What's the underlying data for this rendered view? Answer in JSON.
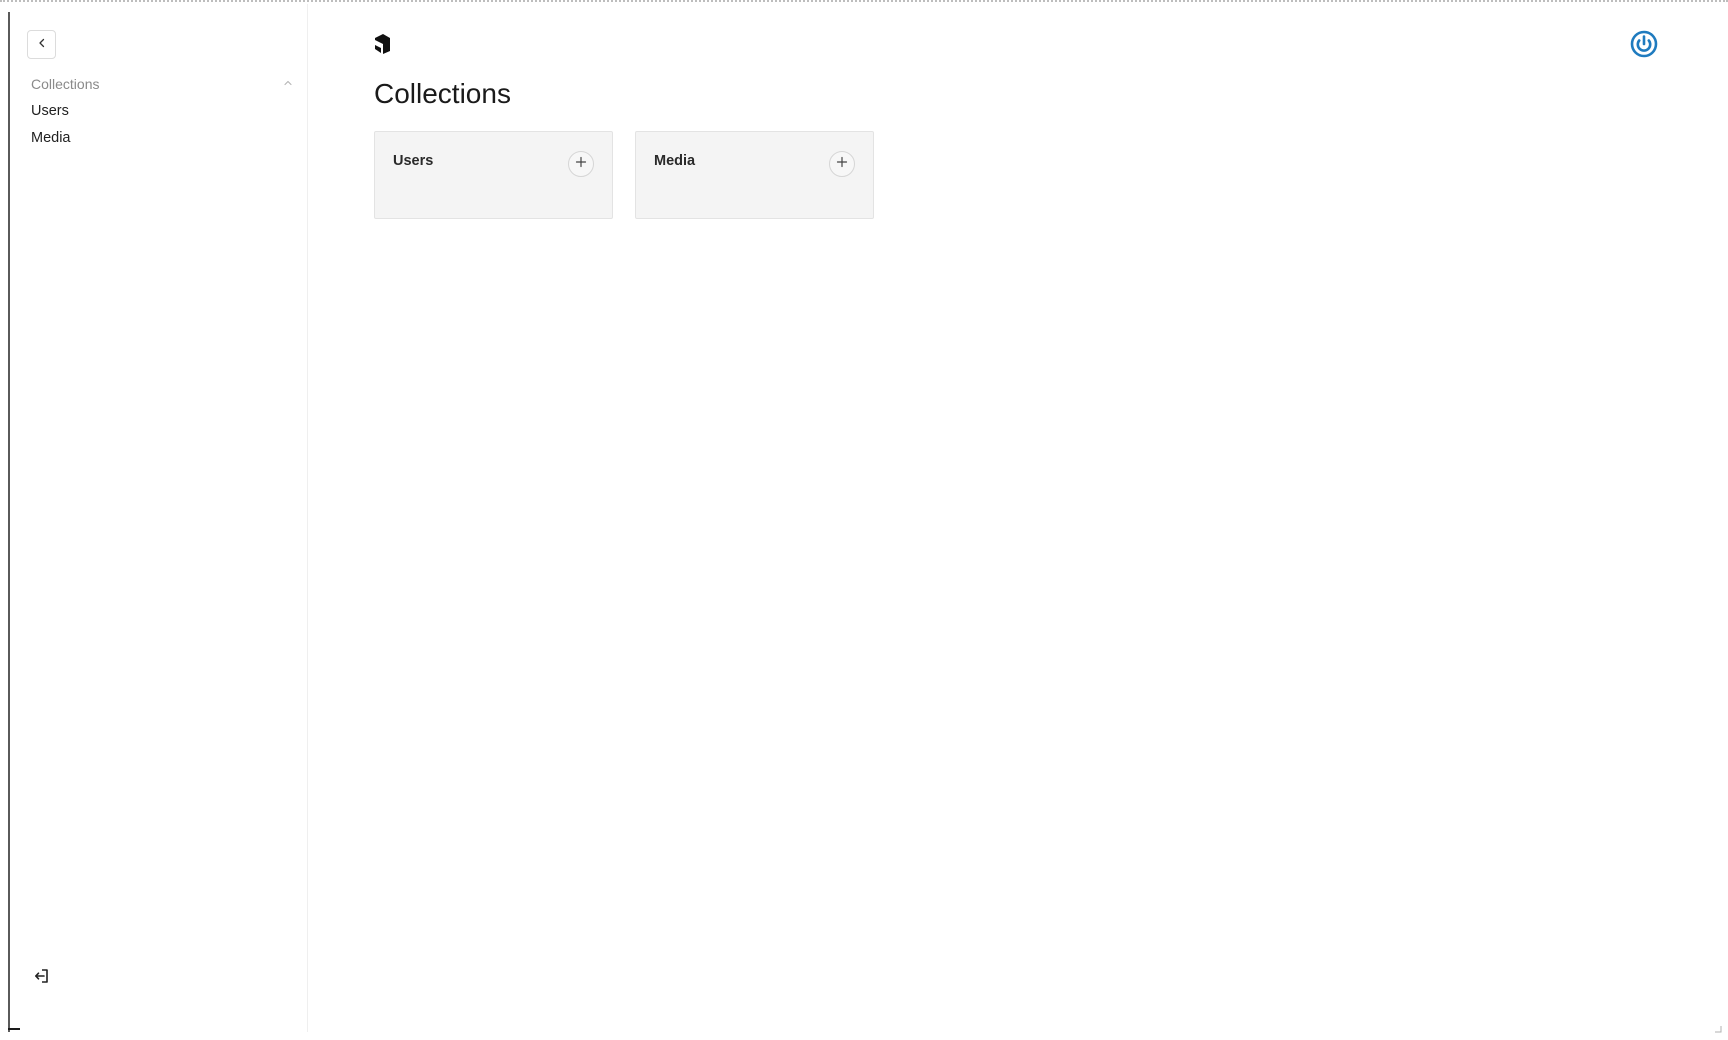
{
  "sidebar": {
    "group_label": "Collections",
    "items": [
      {
        "label": "Users"
      },
      {
        "label": "Media"
      }
    ]
  },
  "main": {
    "title": "Collections",
    "cards": [
      {
        "label": "Users"
      },
      {
        "label": "Media"
      }
    ]
  },
  "icons": {
    "collapse": "chevron-left-icon",
    "group_toggle": "chevron-up-icon",
    "logout": "logout-icon",
    "logo": "logo-icon",
    "account": "account-icon",
    "add": "plus-icon"
  },
  "colors": {
    "accent": "#1f7bbf",
    "card_bg": "#f4f4f4"
  }
}
